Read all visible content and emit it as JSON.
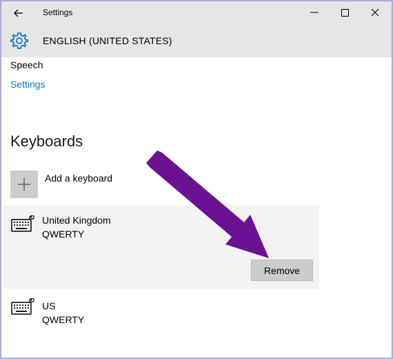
{
  "window": {
    "title": "Settings",
    "back_icon": "back-arrow-icon",
    "controls": [
      "minimize-icon",
      "maximize-icon",
      "close-icon"
    ]
  },
  "header": {
    "icon": "gear-icon",
    "title": "ENGLISH (UNITED STATES)"
  },
  "speech": {
    "label": "Speech",
    "link": "Settings"
  },
  "keyboards": {
    "heading": "Keyboards",
    "add_label": "Add a keyboard",
    "items": [
      {
        "name": "United Kingdom",
        "layout": "QWERTY",
        "selected": true,
        "action": "Remove"
      },
      {
        "name": "US",
        "layout": "QWERTY",
        "selected": false
      }
    ]
  },
  "colors": {
    "accent_link": "#0a76b8",
    "annotation_arrow": "#6a1292",
    "titlebar_bg": "#e6e6e6",
    "selected_bg": "#f2f2f2",
    "button_bg": "#cccccc"
  }
}
